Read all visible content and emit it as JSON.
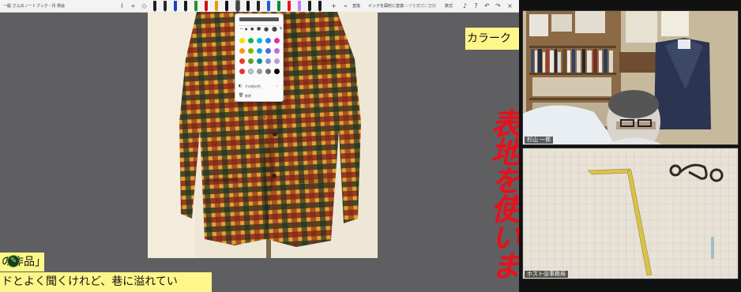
{
  "toolbar": {
    "title": "一般 さんのノートブック・月 例会",
    "convert_label": "変換",
    "ink_to_shape_label": "インクを図形に変換",
    "ink_to_math_label": "インクを数式に変換",
    "math_label": "数式"
  },
  "palette": {
    "more_colors_label": "その他の色",
    "delete_label": "削除",
    "colors": [
      "#f5e100",
      "#22b14c",
      "#00c0c8",
      "#2f80ed",
      "#e02baf",
      "#f39c12",
      "#7fba00",
      "#1aa3d9",
      "#4b6bd8",
      "#c06bd8",
      "#e33b2e",
      "#5e9e2a",
      "#0f8f8f",
      "#7d92c8",
      "#b2a1d6",
      "#e83030",
      "#c8c8c8",
      "#9b9b9b",
      "#6b6b6b",
      "#000000"
    ],
    "strokes": [
      "●",
      "●",
      "●",
      "●",
      "●"
    ]
  },
  "captions": {
    "top_right": "カラーク",
    "bottom_line_1": "の作品」",
    "bottom_line_2": "ドとよく聞くけれど、巷に溢れてい"
  },
  "handwriting": {
    "text": "表地を使いま",
    "color": "#e8101a"
  },
  "video": {
    "participant_1_name": "杉山 一郎",
    "participant_2_name": "ホスト@事務局"
  }
}
